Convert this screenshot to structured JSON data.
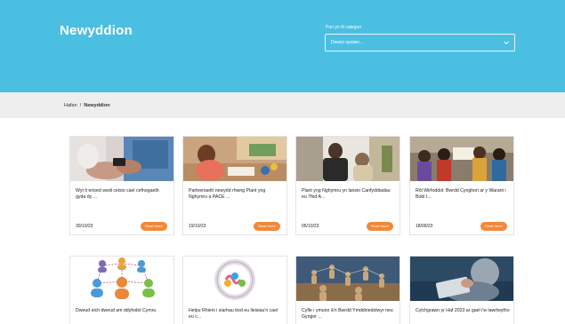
{
  "header": {
    "title": "Newyddion",
    "filter_label": "Pori yn ôl categori",
    "filter_value": "Dewisï opsiwn..."
  },
  "breadcrumb": {
    "home": "Hafan",
    "separator": "/",
    "current": "Newyddion"
  },
  "colors": {
    "hero": "#4bbfe2",
    "button": "#f2883a",
    "crumb_bar": "#eeeeee"
  },
  "articles": [
    {
      "title": "Wyt ti erioed wedi ceisio cael cefnogaeth gyda dy ...",
      "date": "30/10/23",
      "button": "Read more",
      "image": "photo-hands-phone"
    },
    {
      "title": "Partneriaeth newydd rhwng Plant yng Nghymru a PACE ...",
      "date": "19/10/23",
      "button": "Read more",
      "image": "photo-child-drawing"
    },
    {
      "title": "Plant yng Nghymru yn lansio Canfyddiadau eu 7fed A...",
      "date": "05/10/23",
      "button": "Read more",
      "image": "photo-children-window"
    },
    {
      "title": "Rôl Wirfoddol: Bwrdd Cynghori ar y Warant i Bobl I...",
      "date": "18/09/23",
      "button": "Read more",
      "image": "photo-young-people-sign"
    },
    {
      "title": "Dweud eich dweud am ddyfodol Cymru",
      "date": "",
      "button": "",
      "image": "illustration-people-network"
    },
    {
      "title": "Helpu Rhieni i siarhau bod eu lleisiau'n cael eu c...",
      "date": "",
      "button": "",
      "image": "logo-circle-hearts"
    },
    {
      "title": "Cyfle i ymuno â'n Bwrdd Ymddiriedolwyr neu Gyngor ...",
      "date": "",
      "button": "",
      "image": "photo-wooden-figures"
    },
    {
      "title": "Cylchgrawn yr Haf 2023 ar gael i'w lawrlwytho",
      "date": "",
      "button": "",
      "image": "photo-reading-tablet"
    }
  ]
}
